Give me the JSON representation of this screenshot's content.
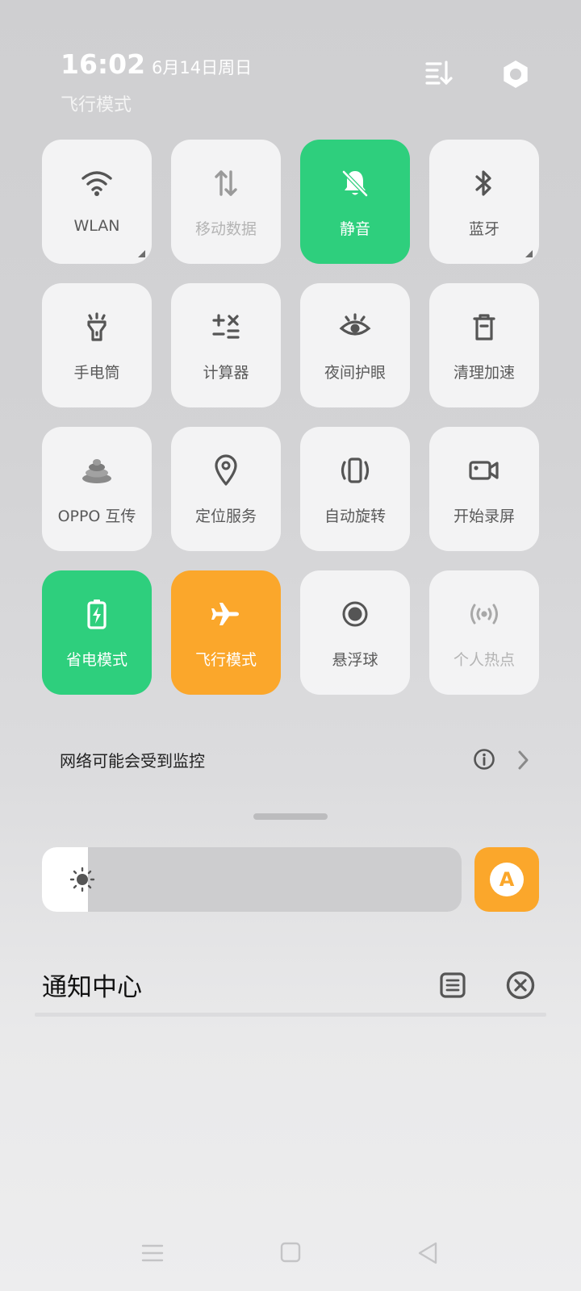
{
  "status": {
    "time": "16:02",
    "date": "6月14日周日",
    "mode": "飞行模式"
  },
  "tiles": [
    {
      "label": "WLAN",
      "icon": "wifi-icon",
      "state": "normal"
    },
    {
      "label": "移动数据",
      "icon": "mobile-data-icon",
      "state": "disabled"
    },
    {
      "label": "静音",
      "icon": "mute-bell-icon",
      "state": "active-green"
    },
    {
      "label": "蓝牙",
      "icon": "bluetooth-icon",
      "state": "normal"
    },
    {
      "label": "手电筒",
      "icon": "flashlight-icon",
      "state": "normal"
    },
    {
      "label": "计算器",
      "icon": "calculator-icon",
      "state": "normal"
    },
    {
      "label": "夜间护眼",
      "icon": "eye-icon",
      "state": "normal"
    },
    {
      "label": "清理加速",
      "icon": "trash-icon",
      "state": "normal"
    },
    {
      "label": "OPPO 互传",
      "icon": "oppo-share-icon",
      "state": "normal"
    },
    {
      "label": "定位服务",
      "icon": "location-pin-icon",
      "state": "normal"
    },
    {
      "label": "自动旋转",
      "icon": "auto-rotate-icon",
      "state": "normal"
    },
    {
      "label": "开始录屏",
      "icon": "screen-record-icon",
      "state": "normal"
    },
    {
      "label": "省电模式",
      "icon": "battery-saver-icon",
      "state": "active-green"
    },
    {
      "label": "飞行模式",
      "icon": "airplane-icon",
      "state": "active-orange"
    },
    {
      "label": "悬浮球",
      "icon": "floating-ball-icon",
      "state": "normal"
    },
    {
      "label": "个人热点",
      "icon": "hotspot-icon",
      "state": "disabled"
    }
  ],
  "network_notice": "网络可能会受到监控",
  "brightness": {
    "level": 0.11,
    "auto_label": "A"
  },
  "notification_center": {
    "title": "通知中心"
  },
  "colors": {
    "green": "#2ecf7d",
    "orange": "#fba72b"
  }
}
